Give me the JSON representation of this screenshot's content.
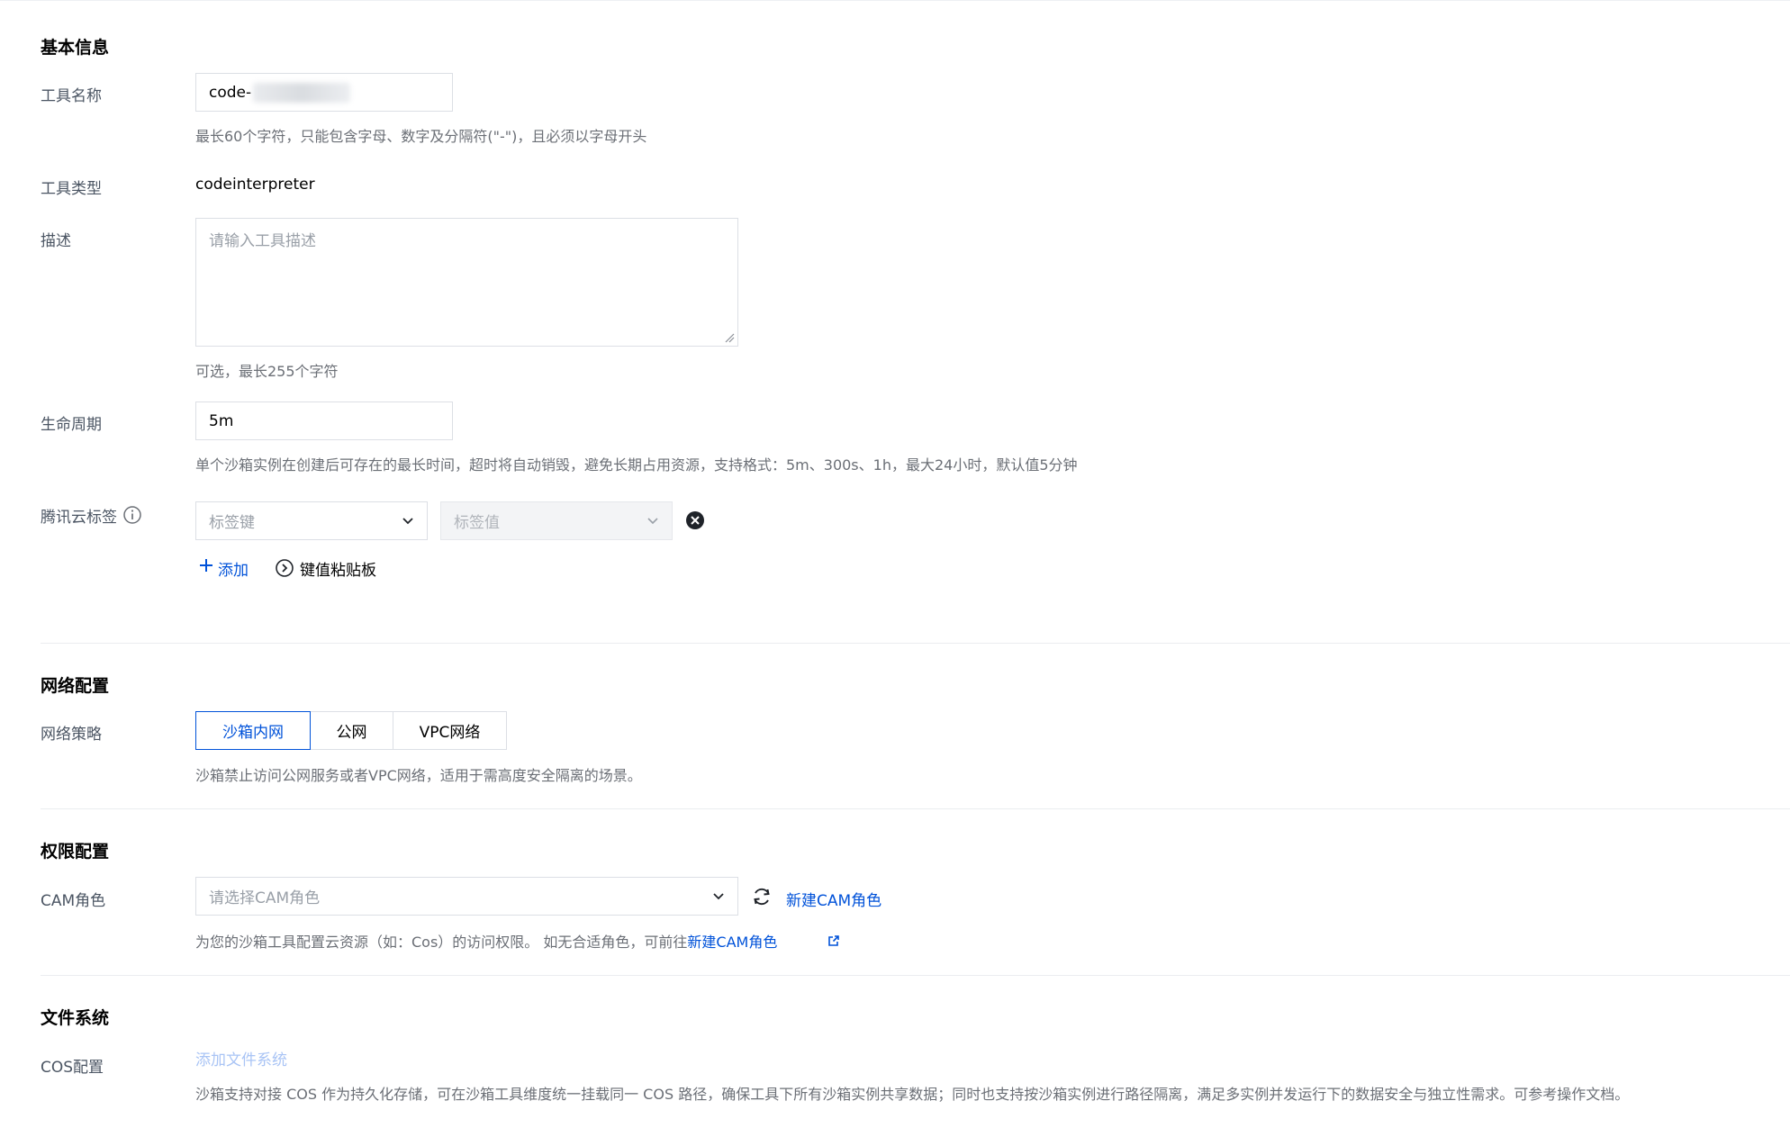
{
  "sections": {
    "basic": {
      "title": "基本信息",
      "tool_name": {
        "label": "工具名称",
        "value": "code-",
        "help": "最长60个字符，只能包含字母、数字及分隔符(\"-\")，且必须以字母开头"
      },
      "tool_type": {
        "label": "工具类型",
        "value": "codeinterpreter"
      },
      "description": {
        "label": "描述",
        "placeholder": "请输入工具描述",
        "help": "可选，最长255个字符"
      },
      "lifecycle": {
        "label": "生命周期",
        "value": "5m",
        "help": "单个沙箱实例在创建后可存在的最长时间，超时将自动销毁，避免长期占用资源，支持格式：5m、300s、1h，最大24小时，默认值5分钟"
      },
      "tags": {
        "label": "腾讯云标签",
        "key_placeholder": "标签键",
        "value_placeholder": "标签值",
        "add_label": "添加",
        "clipboard_label": "键值粘贴板"
      }
    },
    "network": {
      "title": "网络配置",
      "policy": {
        "label": "网络策略",
        "options": [
          "沙箱内网",
          "公网",
          "VPC网络"
        ],
        "selected": "沙箱内网",
        "help": "沙箱禁止访问公网服务或者VPC网络，适用于需高度安全隔离的场景。"
      }
    },
    "permission": {
      "title": "权限配置",
      "cam_role": {
        "label": "CAM角色",
        "placeholder": "请选择CAM角色",
        "create_link": "新建CAM角色",
        "help_prefix": "为您的沙箱工具配置云资源（如：Cos）的访问权限。 如无合适角色，可前往",
        "help_link": "新建CAM角色"
      }
    },
    "filesystem": {
      "title": "文件系统",
      "cos": {
        "label": "COS配置",
        "add_link": "添加文件系统",
        "help": "沙箱支持对接 COS 作为持久化存储，可在沙箱工具维度统一挂载同一 COS 路径，确保工具下所有沙箱实例共享数据；同时也支持按沙箱实例进行路径隔离，满足多实例并发运行下的数据安全与独立性需求。可参考操作文档。"
      }
    }
  },
  "colors": {
    "accent": "#0052d9",
    "label": "#4b5563",
    "help": "#6b6f76",
    "border": "#dcdfe5"
  },
  "icons": [
    "info-icon",
    "chevron-down-icon",
    "clear-circle-icon",
    "plus-icon",
    "play-circle-icon",
    "refresh-icon",
    "external-link-icon",
    "resize-grip-icon"
  ]
}
